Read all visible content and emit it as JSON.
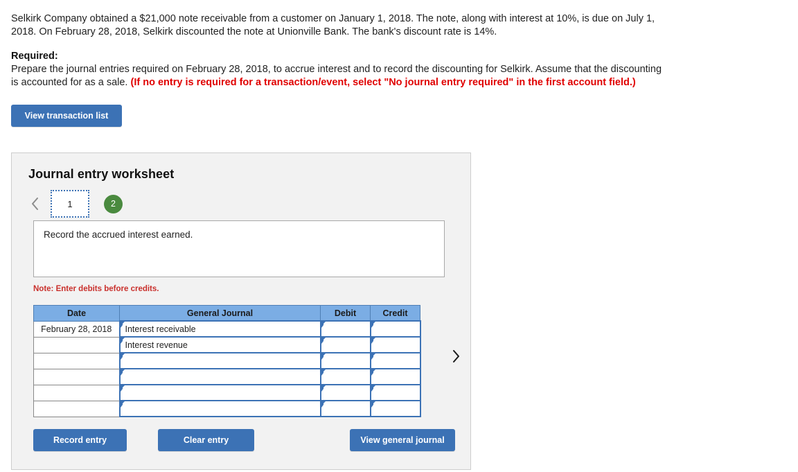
{
  "problem": {
    "statement": "Selkirk Company obtained a $21,000 note receivable from a customer on January 1, 2018. The note, along with interest at 10%, is due on July 1, 2018. On February 28, 2018, Selkirk discounted the note at Unionville Bank. The bank's discount rate is 14%.",
    "required_label": "Required:",
    "required_body": "Prepare the journal entries required on February 28, 2018, to accrue interest and to record the discounting for Selkirk. Assume that the discounting is accounted for as a sale. ",
    "required_emphasis": "(If no entry is required for a transaction/event, select \"No journal entry required\" in the first account field.)"
  },
  "toolbar": {
    "view_transaction_list_label": "View transaction list"
  },
  "worksheet": {
    "title": "Journal entry worksheet",
    "pager": {
      "prev_icon": "chevron-left-icon",
      "next_icon": "chevron-right-icon",
      "tabs": [
        {
          "label": "1",
          "state": "selected"
        },
        {
          "label": "2",
          "state": "completed"
        }
      ]
    },
    "description": "Record the accrued interest earned.",
    "note": "Note: Enter debits before credits.",
    "table": {
      "columns": [
        "Date",
        "General Journal",
        "Debit",
        "Credit"
      ],
      "rows": [
        {
          "date": "February 28, 2018",
          "account": "Interest receivable",
          "debit": "",
          "credit": ""
        },
        {
          "date": "",
          "account": "Interest revenue",
          "debit": "",
          "credit": ""
        },
        {
          "date": "",
          "account": "",
          "debit": "",
          "credit": ""
        },
        {
          "date": "",
          "account": "",
          "debit": "",
          "credit": ""
        },
        {
          "date": "",
          "account": "",
          "debit": "",
          "credit": ""
        },
        {
          "date": "",
          "account": "",
          "debit": "",
          "credit": ""
        }
      ]
    },
    "buttons": {
      "record_entry": "Record entry",
      "clear_entry": "Clear entry",
      "view_general_journal": "View general journal"
    }
  },
  "colors": {
    "button_blue": "#3c72b5",
    "table_header_blue": "#7badE4",
    "cell_border_blue": "#3c72b5",
    "completed_tab_green": "#4a8a3f",
    "note_red": "#c9302c",
    "emphasis_red": "#e00000",
    "panel_background": "#f2f2f2"
  }
}
